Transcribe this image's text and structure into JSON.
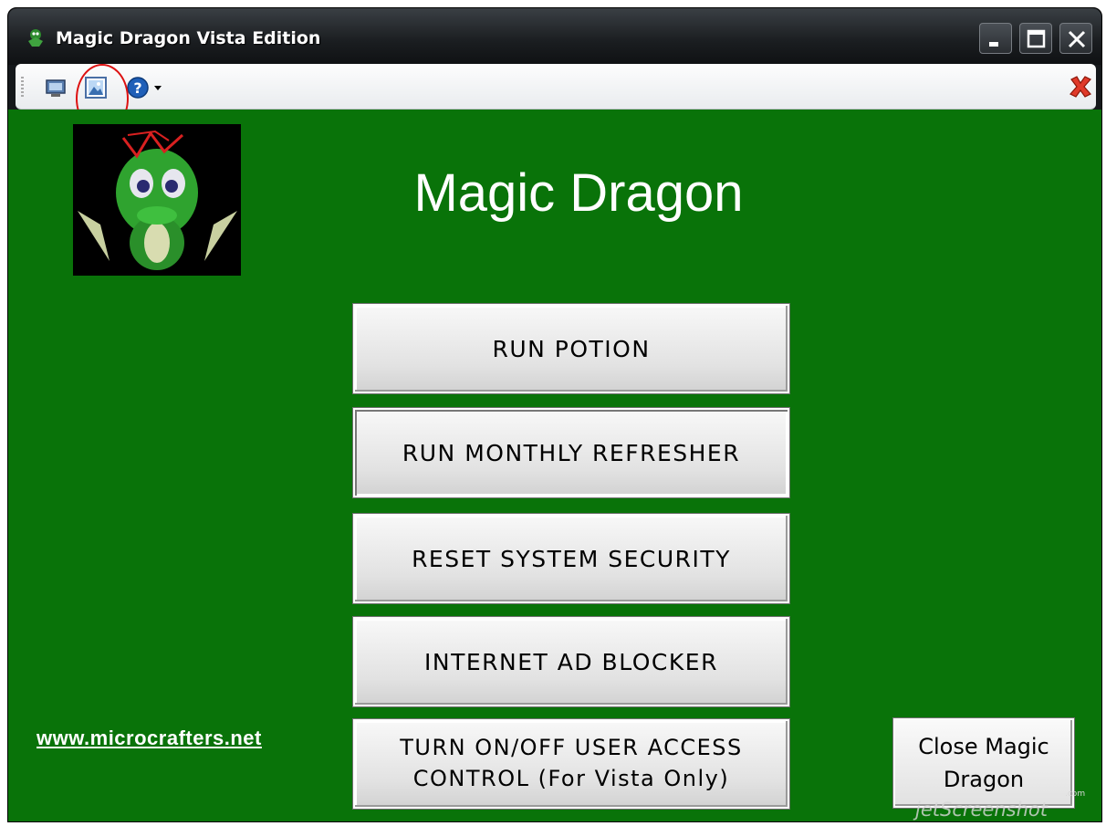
{
  "window": {
    "title": "Magic Dragon Vista Edition"
  },
  "toolbar": {
    "icons": [
      "monitor-icon",
      "image-icon",
      "help-icon",
      "exit-icon"
    ]
  },
  "main": {
    "title": "Magic Dragon",
    "buttons": [
      "RUN POTION",
      "RUN MONTHLY REFRESHER",
      "RESET SYSTEM SECURITY",
      "INTERNET AD BLOCKER",
      "TURN ON/OFF USER ACCESS\nCONTROL (For Vista Only)"
    ],
    "website": "www.microcrafters.net",
    "close_button": "Close Magic\nDragon"
  },
  "watermark": {
    "text": "jetScreenshot",
    "suffix": ".com"
  },
  "colors": {
    "background": "#097309",
    "titlebar": "#1a1d20",
    "button": "#e6e6e6"
  }
}
